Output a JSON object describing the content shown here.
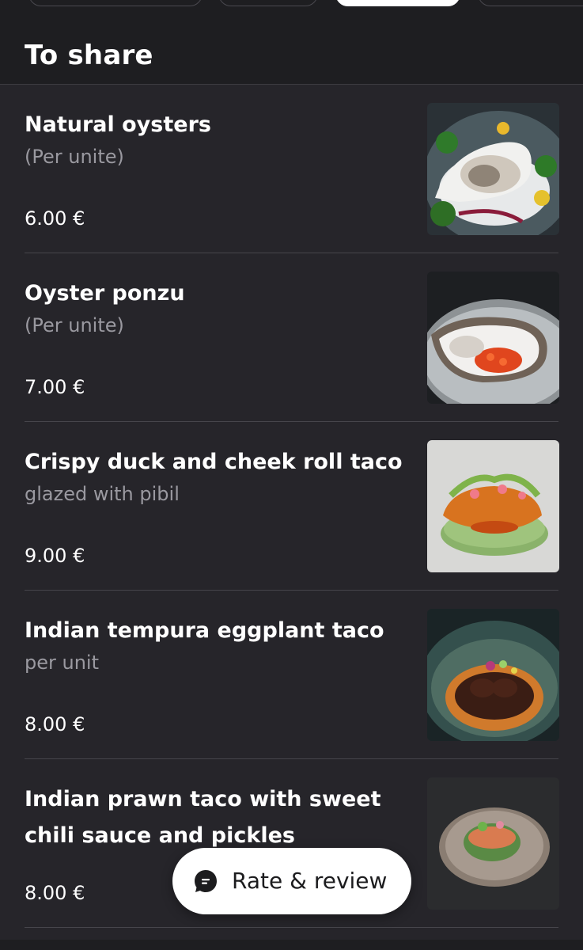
{
  "section": {
    "title": "To share"
  },
  "items": [
    {
      "name": "Natural oysters",
      "desc": "(Per unite)",
      "price": "6.00 €",
      "photo_icon": "oyster-photo"
    },
    {
      "name": "Oyster ponzu",
      "desc": "(Per unite)",
      "price": "7.00 €",
      "photo_icon": "oyster-roe-photo"
    },
    {
      "name": "Crispy duck and cheek roll taco",
      "desc": "glazed with pibil",
      "price": "9.00 €",
      "photo_icon": "duck-taco-photo"
    },
    {
      "name": "Indian tempura eggplant taco",
      "desc": "per unit",
      "price": "8.00 €",
      "photo_icon": "eggplant-taco-photo"
    },
    {
      "name": "Indian prawn taco with sweet chili sauce and pickles",
      "desc": "",
      "price": "8.00 €",
      "photo_icon": "prawn-taco-photo"
    }
  ],
  "rate_button": {
    "label": "Rate & review",
    "icon": "chat-bubble-icon"
  },
  "colors": {
    "background": "#26252a",
    "header": "#1e1e21",
    "text_secondary": "#9a99a0",
    "button_bg": "#ffffff"
  }
}
